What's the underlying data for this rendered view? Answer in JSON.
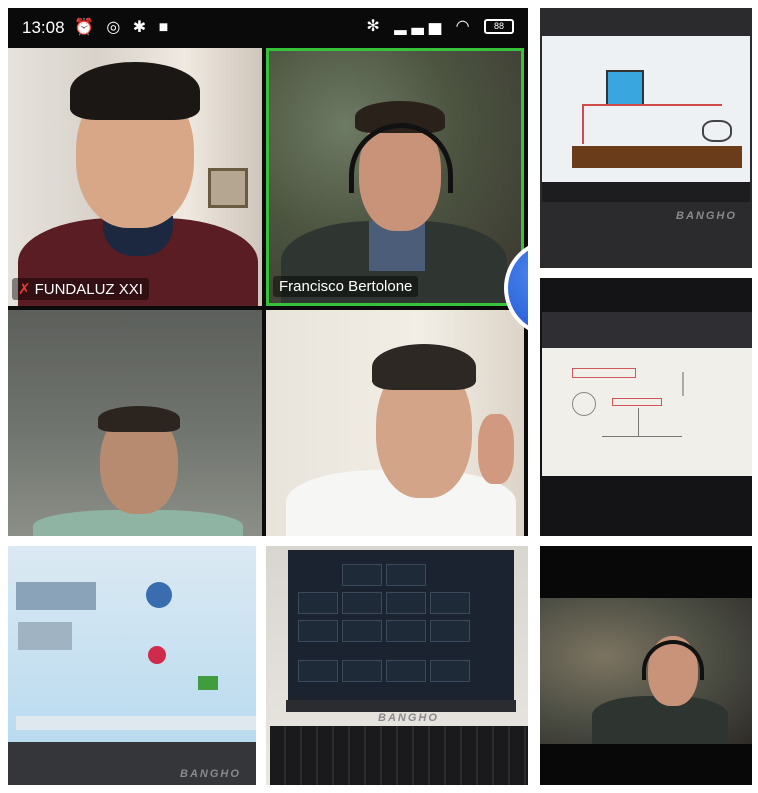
{
  "status_bar": {
    "time": "13:08",
    "battery_level": "88"
  },
  "participants": [
    {
      "name": "FUNDALUZ XXI",
      "mic_muted": true
    },
    {
      "name": "Francisco Bertolone",
      "active_speaker": true
    }
  ],
  "reaction": {
    "icon": "thumbs-up-icon",
    "color": "#2a62df"
  },
  "laptop_brand": "BANGHO",
  "colors": {
    "active_speaker_border": "#37c23b",
    "mic_off": "#e53935"
  }
}
